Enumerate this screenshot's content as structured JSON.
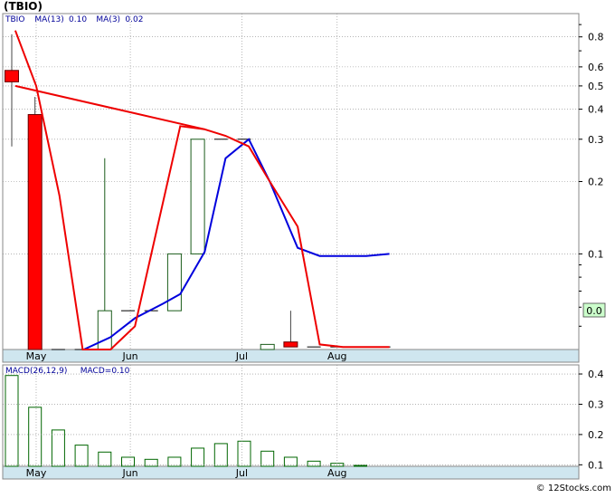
{
  "header": {
    "title": "(TBIO)"
  },
  "watermark": "© 12Stocks.com",
  "colors": {
    "up_candle": "#1a5c1a",
    "down_candle": "#ff0000",
    "ma13": "#0000dd",
    "ma3": "#ee0000",
    "legend_text": "#000099",
    "axis_band": "#cfe6ef",
    "grid": "#888888",
    "last_price_box": "#ccffcc",
    "macd_bar": "#006600"
  },
  "chart_data": [
    {
      "type": "candlestick",
      "title": "(TBIO)",
      "legend": [
        {
          "label": "TBIO",
          "value": "",
          "color": "#000099"
        },
        {
          "label": "MA(13)",
          "value": "0.10",
          "color": "#000099"
        },
        {
          "label": "MA(3)",
          "value": "0.02",
          "color": "#000099"
        }
      ],
      "y_scale": "log",
      "ylim": [
        0.04,
        1.0
      ],
      "y_ticks": [
        {
          "v": 0.8,
          "label": "0.8"
        },
        {
          "v": 0.6,
          "label": "0.6"
        },
        {
          "v": 0.5,
          "label": "0.5"
        },
        {
          "v": 0.4,
          "label": "0.4"
        },
        {
          "v": 0.3,
          "label": "0.3"
        },
        {
          "v": 0.2,
          "label": "0.2"
        },
        {
          "v": 0.1,
          "label": "0.1"
        }
      ],
      "x_labels": [
        {
          "i": 1.05,
          "label": "May"
        },
        {
          "i": 5.1,
          "label": "Jun"
        },
        {
          "i": 9.9,
          "label": "Jul"
        },
        {
          "i": 14.0,
          "label": "Aug"
        }
      ],
      "last_price_label": "0.0",
      "last_price_value": 0.0,
      "candles": [
        {
          "open": 0.58,
          "high": 0.82,
          "low": 0.28,
          "close": 0.52
        },
        {
          "open": 0.38,
          "high": 0.45,
          "low": 0.01,
          "close": 0.01
        },
        {
          "open": 0.01,
          "high": 0.01,
          "low": 0.01,
          "close": 0.01
        },
        {
          "open": 0.01,
          "high": 0.01,
          "low": 0.01,
          "close": 0.01
        },
        {
          "open": 0.01,
          "high": 0.25,
          "low": 0.01,
          "close": 0.058
        },
        {
          "open": 0.058,
          "high": 0.058,
          "low": 0.058,
          "close": 0.058
        },
        {
          "open": 0.058,
          "high": 0.058,
          "low": 0.058,
          "close": 0.058
        },
        {
          "open": 0.058,
          "high": 0.1,
          "low": 0.058,
          "close": 0.1
        },
        {
          "open": 0.1,
          "high": 0.3,
          "low": 0.1,
          "close": 0.3
        },
        {
          "open": 0.3,
          "high": 0.3,
          "low": 0.3,
          "close": 0.3
        },
        {
          "open": 0.3,
          "high": 0.3,
          "low": 0.3,
          "close": 0.3
        },
        {
          "open": 0.038,
          "high": 0.042,
          "low": 0.038,
          "close": 0.042
        },
        {
          "open": 0.043,
          "high": 0.058,
          "low": 0.041,
          "close": 0.041
        },
        {
          "open": 0.041,
          "high": 0.041,
          "low": 0.041,
          "close": 0.041
        },
        {
          "open": 0.041,
          "high": 0.041,
          "low": 0.041,
          "close": 0.041
        },
        {
          "open": 0.041,
          "high": 0.041,
          "low": 0.041,
          "close": 0.041
        },
        {
          "open": 0.041,
          "high": 0.041,
          "low": 0.041,
          "close": 0.041
        }
      ],
      "series": [
        {
          "name": "MA(13)",
          "points": [
            [
              3.1,
              0.01
            ],
            [
              4.25,
              0.045
            ],
            [
              5.3,
              0.054
            ],
            [
              6.5,
              0.062
            ],
            [
              7.25,
              0.068
            ],
            [
              8.3,
              0.102
            ],
            [
              9.2,
              0.25
            ],
            [
              10.2,
              0.3
            ],
            [
              11.1,
              0.2
            ],
            [
              12.3,
              0.106
            ],
            [
              13.25,
              0.098
            ],
            [
              15.25,
              0.098
            ],
            [
              16.25,
              0.1
            ]
          ]
        },
        {
          "name": "MA(3)",
          "points": [
            [
              0.15,
              0.85
            ],
            [
              1.05,
              0.5
            ],
            [
              2.05,
              0.175
            ],
            [
              3.05,
              0.01
            ],
            [
              4.25,
              0.0095
            ],
            [
              5.3,
              0.05
            ],
            [
              7.25,
              0.34
            ],
            [
              8.3,
              0.33
            ],
            [
              9.2,
              0.31
            ],
            [
              10.2,
              0.28
            ],
            [
              11.1,
              0.2
            ],
            [
              12.3,
              0.13
            ],
            [
              13.25,
              0.042
            ],
            [
              14.25,
              0.041
            ],
            [
              16.25,
              0.041
            ]
          ]
        }
      ],
      "ma_long": {
        "name": "MA(13)",
        "points": [
          [
            0.15,
            0.5
          ],
          [
            8.3,
            0.33
          ]
        ]
      }
    },
    {
      "type": "bar",
      "title": "MACD(26,12,9)",
      "legend": [
        {
          "label": "MACD(26,12,9)",
          "value": "",
          "color": "#000099"
        },
        {
          "label": "MACD",
          "value": "0.10",
          "color": "#000099"
        }
      ],
      "y_ticks": [
        {
          "v": 0.4,
          "label": "0.4"
        },
        {
          "v": 0.3,
          "label": "0.3"
        },
        {
          "v": 0.2,
          "label": "0.2"
        },
        {
          "v": 0.1,
          "label": "0.1"
        }
      ],
      "ylim": [
        0.095,
        0.43
      ],
      "x_labels": [
        {
          "i": 1.05,
          "label": "May"
        },
        {
          "i": 5.1,
          "label": "Jun"
        },
        {
          "i": 9.9,
          "label": "Jul"
        },
        {
          "i": 14.0,
          "label": "Aug"
        }
      ],
      "values": [
        0.395,
        0.29,
        0.215,
        0.165,
        0.142,
        0.125,
        0.118,
        0.125,
        0.155,
        0.17,
        0.178,
        0.145,
        0.125,
        0.112,
        0.105,
        0.098
      ]
    }
  ]
}
